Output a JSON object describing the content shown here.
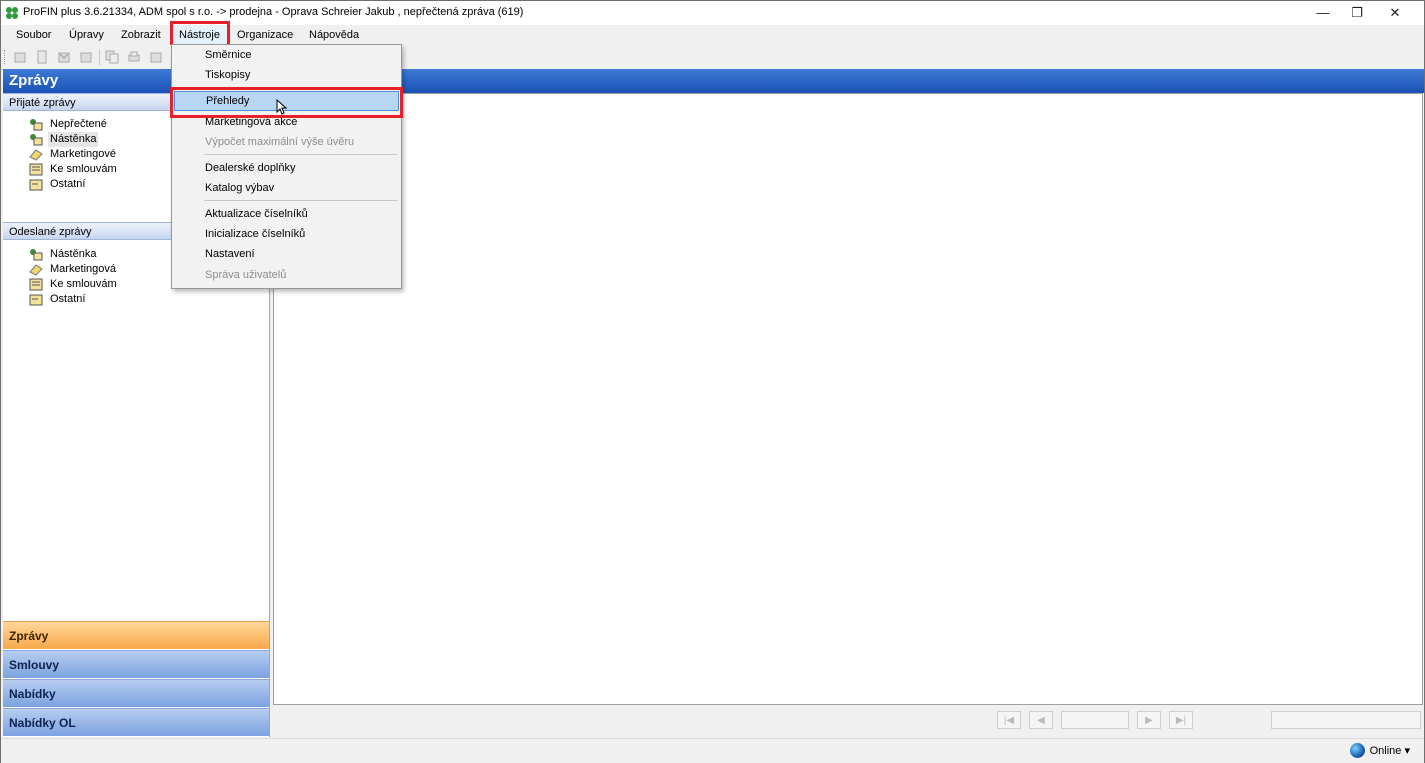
{
  "window": {
    "title": "ProFIN plus 3.6.21334, ADM spol s r.o. -> prodejna - Oprava Schreier Jakub , nepřečtená zpráva (619)",
    "minimize_glyph": "—",
    "maximize_glyph": "❐",
    "close_glyph": "✕"
  },
  "menubar": {
    "items": [
      "Soubor",
      "Úpravy",
      "Zobrazit",
      "Nástroje",
      "Organizace",
      "Nápověda"
    ],
    "active": "Nástroje"
  },
  "dropdown": {
    "items": [
      {
        "label": "Směrnice",
        "disabled": false
      },
      {
        "label": "Tiskopisy",
        "disabled": false
      },
      {
        "label": "Přehledy",
        "disabled": false,
        "highlighted": true
      },
      {
        "label": "Marketingová akce",
        "disabled": false
      },
      {
        "label": "Výpočet maximální výše úvěru",
        "disabled": true
      },
      {
        "label": "Dealerské doplňky",
        "disabled": false
      },
      {
        "label": "Katalog výbav",
        "disabled": false
      },
      {
        "label": "Aktualizace číselníků",
        "disabled": false
      },
      {
        "label": "Inicializace číselníků",
        "disabled": false
      },
      {
        "label": "Nastavení",
        "disabled": false
      },
      {
        "label": "Správa uživatelů",
        "disabled": true
      }
    ]
  },
  "left_pane": {
    "title": "Zprávy",
    "received": {
      "header": "Přijaté zprávy",
      "items": [
        "Nepřečtené",
        "Nástěnka",
        "Marketingové",
        "Ke smlouvám",
        "Ostatní"
      ],
      "selected": "Nástěnka"
    },
    "sent": {
      "header": "Odeslané zprávy",
      "items": [
        "Nástěnka",
        "Marketingová",
        "Ke smlouvám",
        "Ostatní"
      ]
    },
    "nav_buttons": [
      "Zprávy",
      "Smlouvy",
      "Nabídky",
      "Nabídky OL"
    ],
    "active_nav": "Zprávy"
  },
  "pager": {
    "first": "|◀",
    "prev": "◀",
    "next": "▶",
    "last": "▶|"
  },
  "status": {
    "online_label": "Online ▾"
  },
  "colors": {
    "highlight_box": "#e8202a",
    "header_blue": "#1b52b4",
    "active_nav_orange": "#f7a84a"
  }
}
